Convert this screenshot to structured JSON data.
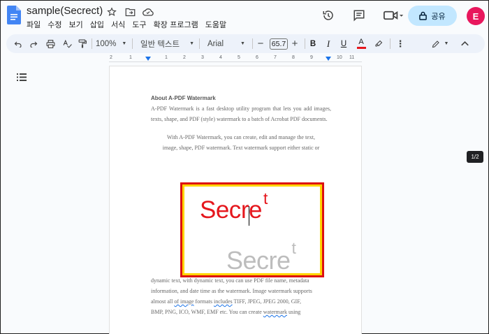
{
  "doc": {
    "title": "sample(Secrect)"
  },
  "menu": [
    "파일",
    "수정",
    "보기",
    "삽입",
    "서식",
    "도구",
    "확장 프로그램",
    "도움말"
  ],
  "share": {
    "label": "공유"
  },
  "avatar": {
    "letter": "E",
    "color": "#e8175d"
  },
  "toolbar": {
    "zoom": "100%",
    "style": "일반 텍스트",
    "font": "Arial",
    "font_size": "65.7"
  },
  "ruler": {
    "ticks": [
      "2",
      "1",
      "1",
      "2",
      "3",
      "4",
      "5",
      "6",
      "7",
      "8",
      "9",
      "10",
      "11"
    ]
  },
  "page_count": "1/2",
  "document": {
    "heading": "About A-PDF Watermark",
    "para1": "A-PDF Watermark is a fast desktop utility program that lets you add images, texts, shape, and PDF (style) watermark to a batch of Acrobat PDF documents.",
    "para2_line1": "With A-PDF Watermark, you can create, edit and manage the text,",
    "para2_line2": "image, shape, PDF watermark. Text watermark support either static or",
    "embed_text1_a": "Sec",
    "embed_text1_b": "re",
    "embed_text1_sup": "t",
    "embed_text2": "Secre",
    "embed_text2_sup": "t",
    "after_1": "dynamic text, with dynamic text, you can use PDF file name, metadata",
    "after_2": "information, and date time as the watermark. Image watermark supports",
    "after_3a": "almost all ",
    "after_3b": "of image",
    "after_3c": " formats ",
    "after_3d": "includes",
    "after_3e": " TIFF, JPEG, JPEG 2000, GIF,",
    "after_4a": "BMP, PNG, ICO, WMF, EMF etc. You can create ",
    "after_4b": "watermark",
    "after_4c": " using"
  },
  "colors": {
    "accent": "#0b57d0",
    "share_bg": "#c2e7ff",
    "highlight_border": "#d11",
    "frame": "#ffd400",
    "text_red": "#e5171d"
  }
}
